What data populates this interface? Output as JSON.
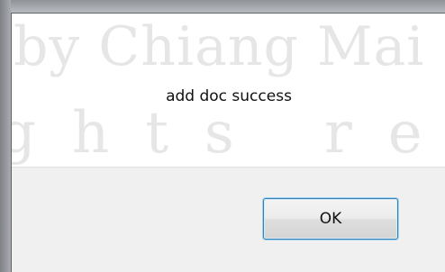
{
  "dialog": {
    "message": "add doc success",
    "ok_label": "OK"
  },
  "watermark": {
    "line1": "by Chiang Mai",
    "line2": "ghts res"
  },
  "colors": {
    "frame": "#8f9296",
    "button_area": "#f0f0f0",
    "button_border": "#3c7fb1",
    "watermark": "#e6e6e6"
  }
}
